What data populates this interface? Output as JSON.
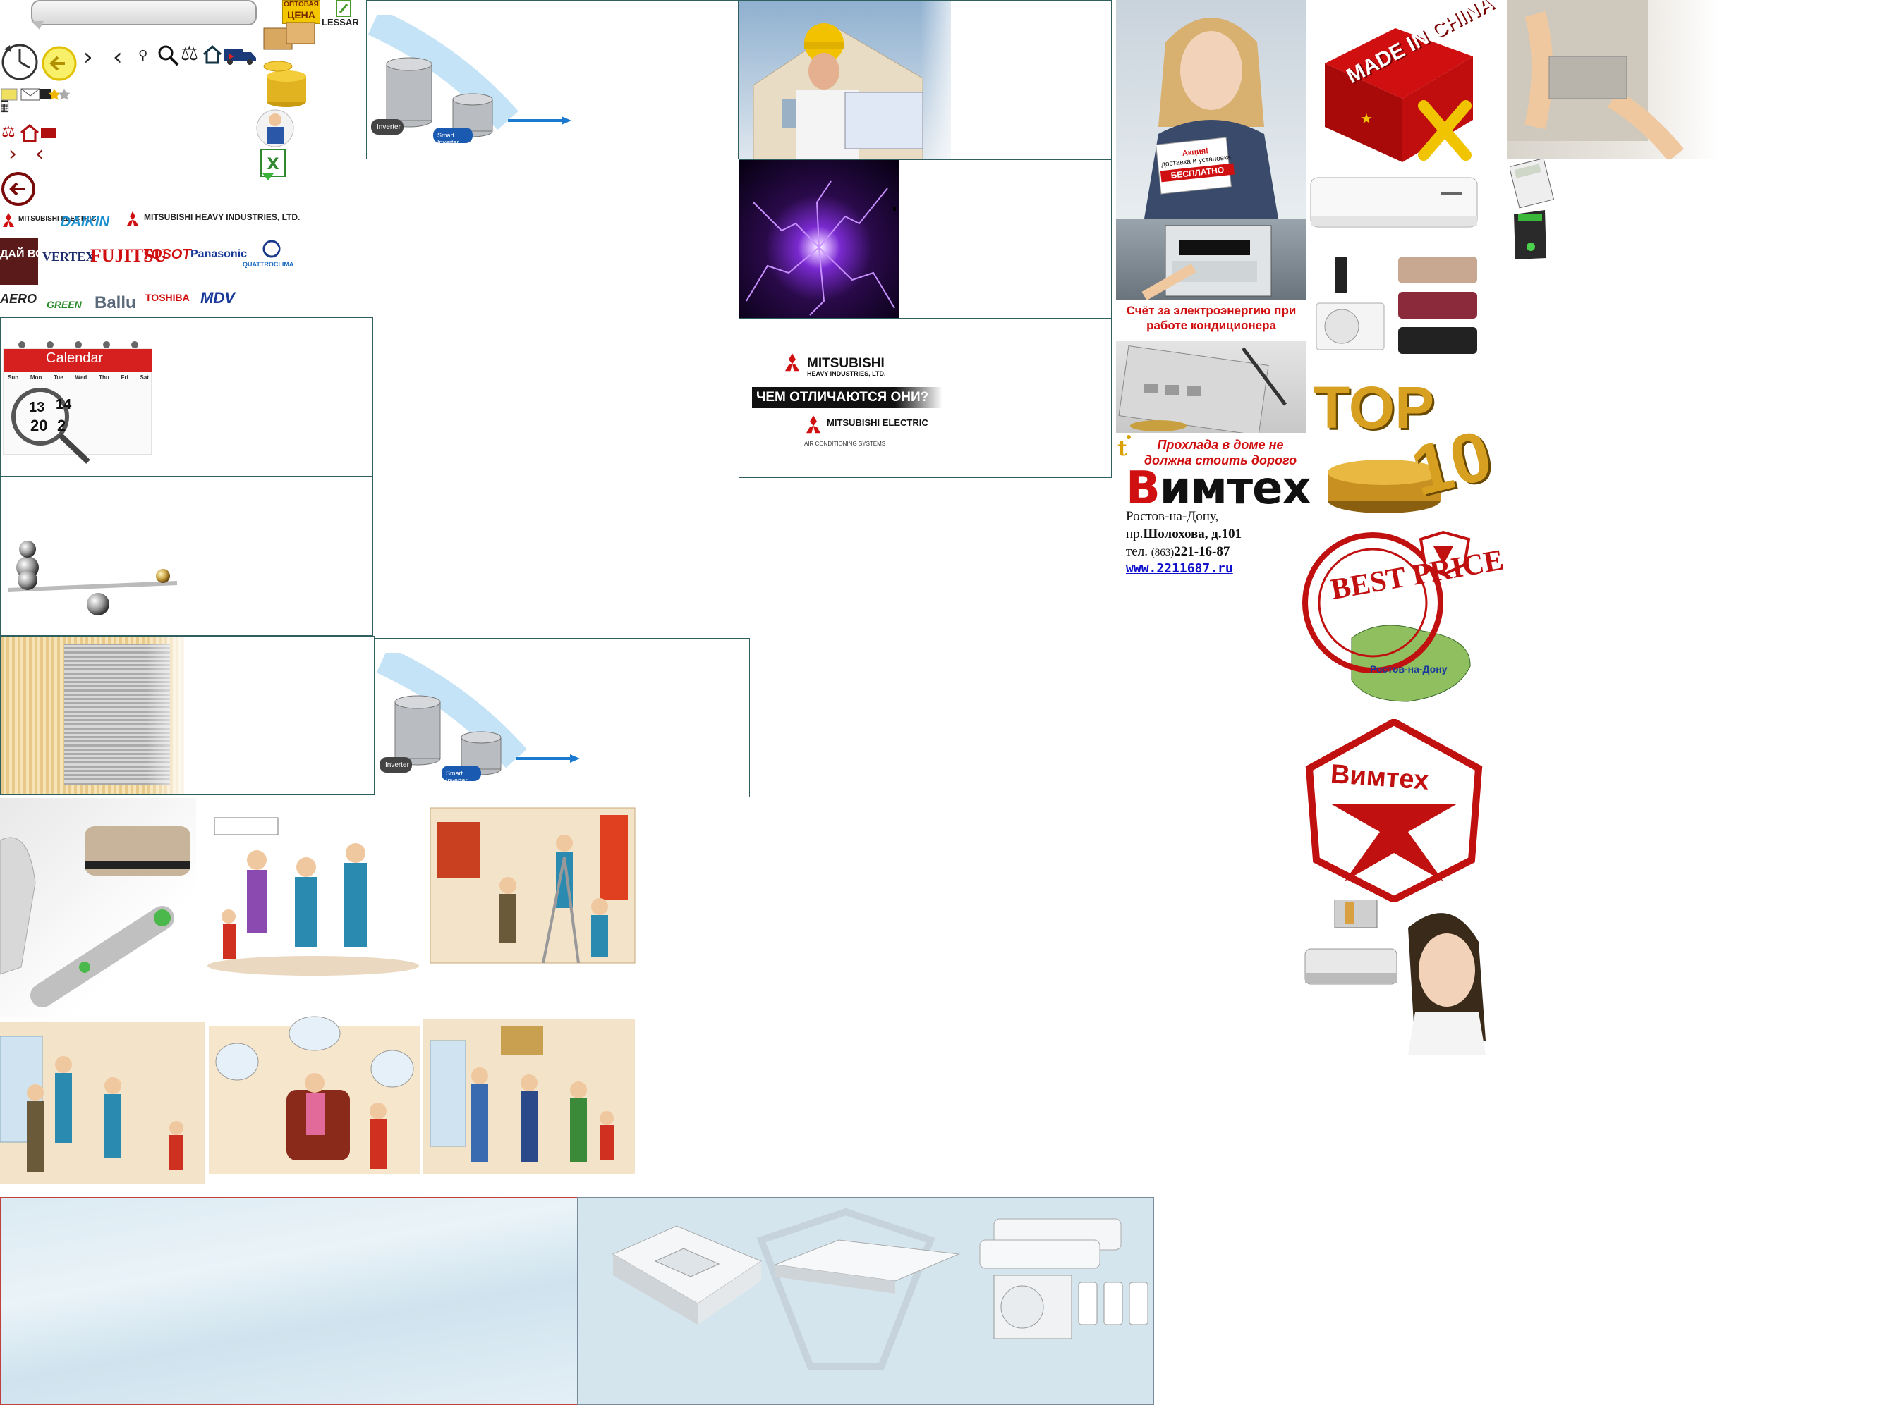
{
  "toolbar": {
    "pill_text": "",
    "icons": [
      "clock-icon",
      "back-circle-icon",
      "chevron-right-icon",
      "chevron-left-icon",
      "search-small-icon",
      "search-icon",
      "scales-icon",
      "home-icon",
      "truck-icon",
      "mail-icon",
      "star-icon",
      "calculator-icon",
      "arrow-left-circle-icon"
    ]
  },
  "promo": {
    "wholesale_line1": "ОПТОВАЯ",
    "wholesale_line2": "ЦЕНА",
    "lessar": "LESSAR"
  },
  "brands_row1": [
    "MITSUBISHI ELECTRIC",
    "DAIKIN",
    "MITSUBISHI HEAVY INDUSTRIES, LTD."
  ],
  "brands_row2": [
    "ДАЙ ВО",
    "VERTEX",
    "FUJITSU",
    "TOSOT",
    "Panasonic",
    "QUATTROCLIMA"
  ],
  "brands_row3": [
    "AERO",
    "GREEN",
    "Ballu",
    "TOSHIBA",
    "MDV"
  ],
  "calendar": {
    "title": "Calendar",
    "days": [
      "Sun",
      "Mon",
      "Tue",
      "Wed",
      "Thu",
      "Fri",
      "Sat"
    ],
    "big_numbers": [
      "13",
      "14",
      "20",
      "2"
    ]
  },
  "inverter": {
    "label1": "Inverter",
    "label2": "Smart Inverter"
  },
  "mitsubishi_compare": {
    "heavy": "MITSUBISHI",
    "heavy_sub": "HEAVY INDUSTRIES, LTD.",
    "question": "ЧЕМ ОТЛИЧАЮТСЯ ОНИ?",
    "electric": "MITSUBISHI ELECTRIC",
    "electric_sub": "AIR CONDITIONING SYSTEMS"
  },
  "girl_card": {
    "line1": "Акция!",
    "line2": "доставка и установка",
    "line3": "БЕСПЛАТНО"
  },
  "electricity": {
    "caption": "Счёт за электроэнергию при работе кондиционера"
  },
  "vimtech": {
    "slogan": "Прохлада в доме не должна стоить дорого",
    "brand_first": "В",
    "brand_rest": "имтех",
    "city": "Ростов-на-Дону,",
    "street_prefix": "пр.",
    "street": "Шолохова, д.101",
    "tel_prefix": "тел. ",
    "tel_code": "(863)",
    "tel": "221-16-87",
    "site": "www.2211687.ru"
  },
  "badges": {
    "made_in_china": "MADE IN CHINA",
    "top": "TOP",
    "ten": "10",
    "best_price": "BEST PRICE",
    "best_price_ring": "BEST PRICE",
    "rostov": "Ростов-на-Дону",
    "vimtech_logo": "Вимтех"
  },
  "colors": {
    "tile_border": "#2f5f5f",
    "brand_red": "#d01010",
    "link_blue": "#1010cc",
    "panel_blue": "#dbeaf2"
  }
}
